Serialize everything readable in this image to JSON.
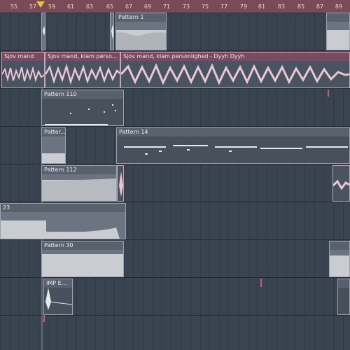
{
  "ruler": {
    "ticks": [
      "55",
      "57",
      "59",
      "61",
      "63",
      "65",
      "67",
      "69",
      "71",
      "73",
      "75",
      "77",
      "79",
      "81",
      "83",
      "85",
      "87",
      "89"
    ]
  },
  "tracks": {
    "clip_pattern1": "Pattern 1",
    "clip_audio1": "Sjov mand",
    "clip_audio2": "Sjov mand, klam perso...",
    "clip_audio3": "Sjov mand, klam personlighed - Dyyh Dyyh",
    "clip_pattern110": "Pattern 110",
    "clip_pattern_short": "Patter...",
    "clip_pattern14": "Pattern 14",
    "clip_pattern112": "Pattern 112",
    "clip_23": "23",
    "clip_pattern30": "Pattern 30",
    "clip_imp": "IMP E..."
  },
  "colors": {
    "ruler_bg": "#7a4a56",
    "playhead": "#f0c040",
    "audio_clip": "#7a4a60",
    "pattern_clip": "#59616c"
  }
}
